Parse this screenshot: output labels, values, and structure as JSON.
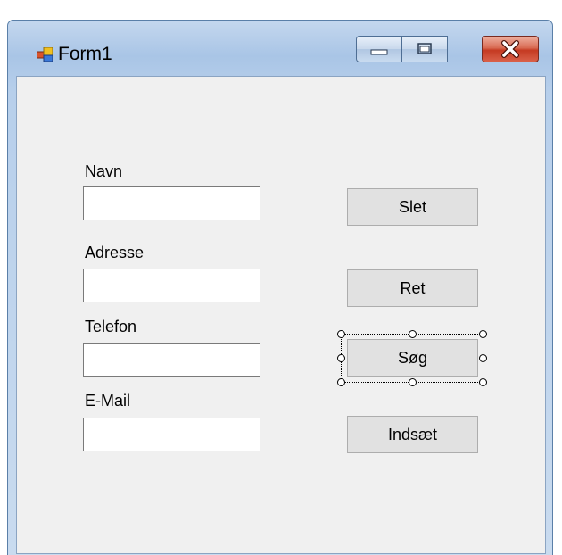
{
  "window": {
    "title": "Form1"
  },
  "icons": {
    "app": "form-app-icon",
    "minimize": "minimize-icon",
    "maximize": "maximize-icon",
    "close": "close-icon"
  },
  "form": {
    "fields": [
      {
        "label": "Navn",
        "value": ""
      },
      {
        "label": "Adresse",
        "value": ""
      },
      {
        "label": "Telefon",
        "value": ""
      },
      {
        "label": "E-Mail",
        "value": ""
      }
    ],
    "buttons": [
      {
        "label": "Slet"
      },
      {
        "label": "Ret"
      },
      {
        "label": "Søg",
        "selected": true
      },
      {
        "label": "Indsæt"
      }
    ]
  }
}
